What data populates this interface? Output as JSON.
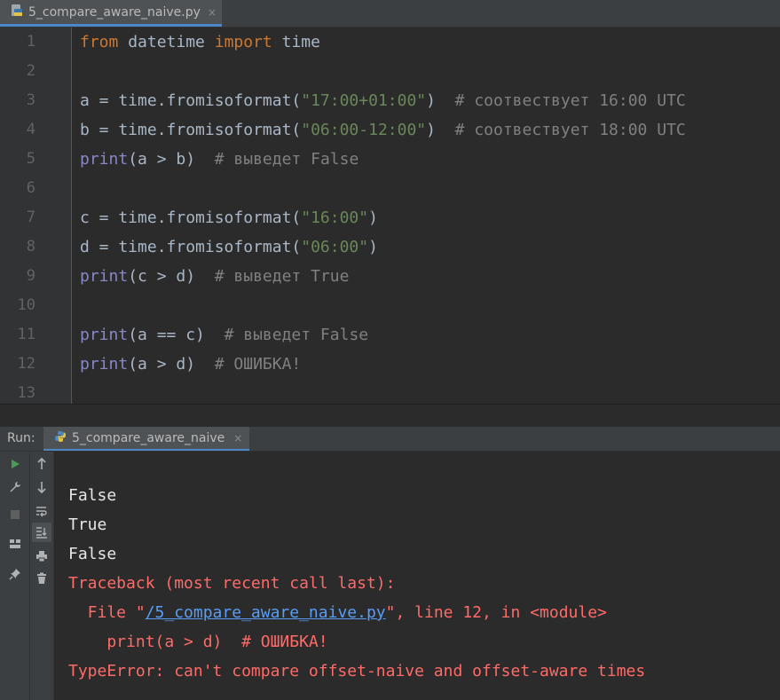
{
  "editor_tab": {
    "filename": "5_compare_aware_naive.py",
    "close": "×"
  },
  "editor": {
    "lines": [
      {
        "num": "1",
        "tokens": [
          {
            "t": "from",
            "c": "kw"
          },
          {
            "t": " datetime ",
            "c": "id"
          },
          {
            "t": "import",
            "c": "kw"
          },
          {
            "t": " time",
            "c": "id"
          }
        ]
      },
      {
        "num": "2",
        "tokens": []
      },
      {
        "num": "3",
        "tokens": [
          {
            "t": "a = time.fromisoformat(",
            "c": "id"
          },
          {
            "t": "\"17:00+01:00\"",
            "c": "str"
          },
          {
            "t": ")  ",
            "c": "id"
          },
          {
            "t": "# соотвествует 16:00 UTC",
            "c": "cm"
          }
        ]
      },
      {
        "num": "4",
        "tokens": [
          {
            "t": "b = time.fromisoformat(",
            "c": "id"
          },
          {
            "t": "\"06:00-12:00\"",
            "c": "str"
          },
          {
            "t": ")  ",
            "c": "id"
          },
          {
            "t": "# соотвествует 18:00 UTC",
            "c": "cm"
          }
        ]
      },
      {
        "num": "5",
        "tokens": [
          {
            "t": "print",
            "c": "fn"
          },
          {
            "t": "(a > b)  ",
            "c": "id"
          },
          {
            "t": "# выведет False",
            "c": "cm"
          }
        ]
      },
      {
        "num": "6",
        "tokens": []
      },
      {
        "num": "7",
        "tokens": [
          {
            "t": "c = time.fromisoformat(",
            "c": "id"
          },
          {
            "t": "\"16:00\"",
            "c": "str"
          },
          {
            "t": ")",
            "c": "id"
          }
        ]
      },
      {
        "num": "8",
        "tokens": [
          {
            "t": "d = time.fromisoformat(",
            "c": "id"
          },
          {
            "t": "\"06:00\"",
            "c": "str"
          },
          {
            "t": ")",
            "c": "id"
          }
        ]
      },
      {
        "num": "9",
        "tokens": [
          {
            "t": "print",
            "c": "fn"
          },
          {
            "t": "(c > d)  ",
            "c": "id"
          },
          {
            "t": "# выведет True",
            "c": "cm"
          }
        ]
      },
      {
        "num": "10",
        "tokens": []
      },
      {
        "num": "11",
        "tokens": [
          {
            "t": "print",
            "c": "fn"
          },
          {
            "t": "(a == c)  ",
            "c": "id"
          },
          {
            "t": "# выведет False",
            "c": "cm"
          }
        ]
      },
      {
        "num": "12",
        "tokens": [
          {
            "t": "print",
            "c": "fn"
          },
          {
            "t": "(a > d)  ",
            "c": "id"
          },
          {
            "t": "# ОШИБКА!",
            "c": "cm"
          }
        ]
      },
      {
        "num": "13",
        "tokens": []
      }
    ]
  },
  "run_panel": {
    "label": "Run:",
    "config_name": "5_compare_aware_naive",
    "close": "×",
    "toolbar_left": [
      "run-icon",
      "wrench-icon",
      "stop-icon",
      "layout-icon",
      "pin-icon"
    ],
    "toolbar_right": [
      "up-arrow-icon",
      "down-arrow-icon",
      "soft-wrap-icon",
      "scroll-to-end-icon",
      "print-icon",
      "trash-icon"
    ]
  },
  "console": {
    "out1": "False",
    "out2": "True",
    "out3": "False",
    "traceback": "Traceback (most recent call last):",
    "file_prefix": "  File \"",
    "file_link": "/5_compare_aware_naive.py",
    "file_suffix": "\", line 12, in <module>",
    "code_line": "    print(a > d)  # ОШИБКА!",
    "error": "TypeError: can't compare offset-naive and offset-aware times"
  },
  "colors": {
    "keyword": "#cc7832",
    "builtin": "#8888c6",
    "string": "#6a8759",
    "comment": "#808080",
    "error": "#ff6b68",
    "link": "#589df6",
    "run_green": "#499c54"
  }
}
